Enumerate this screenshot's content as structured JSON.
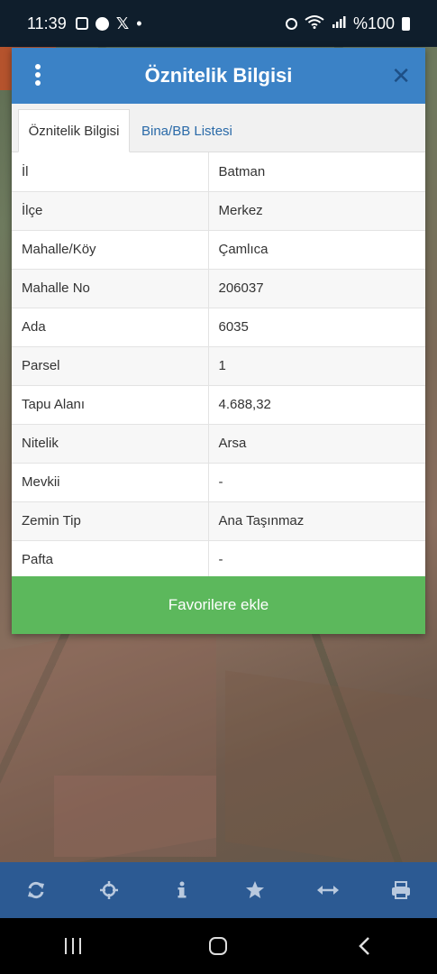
{
  "status_bar": {
    "time": "11:39",
    "battery": "%100"
  },
  "modal": {
    "title": "Öznitelik Bilgisi",
    "tabs": [
      {
        "label": "Öznitelik Bilgisi",
        "active": true
      },
      {
        "label": "Bina/BB Listesi",
        "active": false
      }
    ],
    "rows": [
      {
        "key": "İl",
        "value": "Batman"
      },
      {
        "key": "İlçe",
        "value": "Merkez"
      },
      {
        "key": "Mahalle/Köy",
        "value": "Çamlıca"
      },
      {
        "key": "Mahalle No",
        "value": "206037"
      },
      {
        "key": "Ada",
        "value": "6035"
      },
      {
        "key": "Parsel",
        "value": "1"
      },
      {
        "key": "Tapu Alanı",
        "value": "4.688,32"
      },
      {
        "key": "Nitelik",
        "value": "Arsa"
      },
      {
        "key": "Mevkii",
        "value": "-"
      },
      {
        "key": "Zemin Tip",
        "value": "Ana Taşınmaz"
      },
      {
        "key": "Pafta",
        "value": "-"
      }
    ],
    "favorite_label": "Favorilere ekle"
  },
  "toolbar": {
    "icons": [
      "refresh-icon",
      "crosshair-icon",
      "info-icon",
      "star-icon",
      "measure-icon",
      "print-icon"
    ]
  },
  "colors": {
    "header": "#3b82c6",
    "favorite": "#5cb85c",
    "toolbar": "#2c5a93",
    "tab_link": "#2a6aa8"
  }
}
